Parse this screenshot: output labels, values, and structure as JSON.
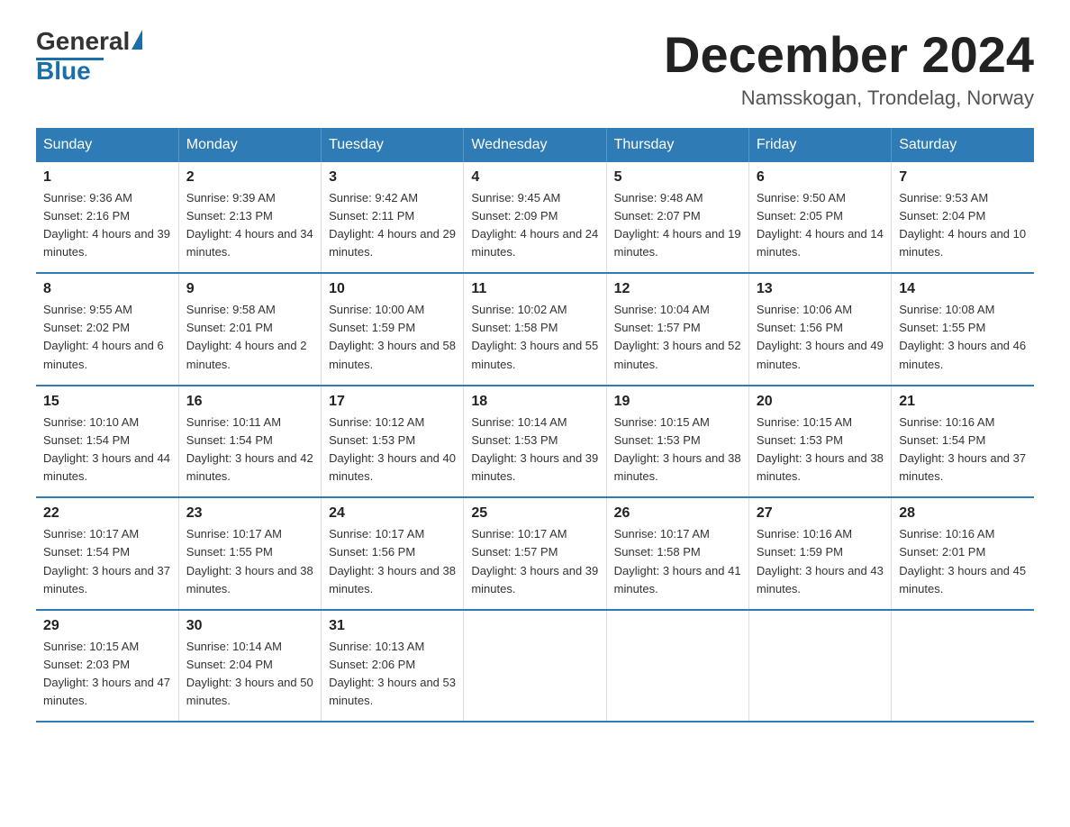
{
  "header": {
    "logo_general": "General",
    "logo_blue": "Blue",
    "month_title": "December 2024",
    "location": "Namsskogan, Trondelag, Norway"
  },
  "days_of_week": [
    "Sunday",
    "Monday",
    "Tuesday",
    "Wednesday",
    "Thursday",
    "Friday",
    "Saturday"
  ],
  "weeks": [
    [
      {
        "day": "1",
        "sunrise": "9:36 AM",
        "sunset": "2:16 PM",
        "daylight": "4 hours and 39 minutes."
      },
      {
        "day": "2",
        "sunrise": "9:39 AM",
        "sunset": "2:13 PM",
        "daylight": "4 hours and 34 minutes."
      },
      {
        "day": "3",
        "sunrise": "9:42 AM",
        "sunset": "2:11 PM",
        "daylight": "4 hours and 29 minutes."
      },
      {
        "day": "4",
        "sunrise": "9:45 AM",
        "sunset": "2:09 PM",
        "daylight": "4 hours and 24 minutes."
      },
      {
        "day": "5",
        "sunrise": "9:48 AM",
        "sunset": "2:07 PM",
        "daylight": "4 hours and 19 minutes."
      },
      {
        "day": "6",
        "sunrise": "9:50 AM",
        "sunset": "2:05 PM",
        "daylight": "4 hours and 14 minutes."
      },
      {
        "day": "7",
        "sunrise": "9:53 AM",
        "sunset": "2:04 PM",
        "daylight": "4 hours and 10 minutes."
      }
    ],
    [
      {
        "day": "8",
        "sunrise": "9:55 AM",
        "sunset": "2:02 PM",
        "daylight": "4 hours and 6 minutes."
      },
      {
        "day": "9",
        "sunrise": "9:58 AM",
        "sunset": "2:01 PM",
        "daylight": "4 hours and 2 minutes."
      },
      {
        "day": "10",
        "sunrise": "10:00 AM",
        "sunset": "1:59 PM",
        "daylight": "3 hours and 58 minutes."
      },
      {
        "day": "11",
        "sunrise": "10:02 AM",
        "sunset": "1:58 PM",
        "daylight": "3 hours and 55 minutes."
      },
      {
        "day": "12",
        "sunrise": "10:04 AM",
        "sunset": "1:57 PM",
        "daylight": "3 hours and 52 minutes."
      },
      {
        "day": "13",
        "sunrise": "10:06 AM",
        "sunset": "1:56 PM",
        "daylight": "3 hours and 49 minutes."
      },
      {
        "day": "14",
        "sunrise": "10:08 AM",
        "sunset": "1:55 PM",
        "daylight": "3 hours and 46 minutes."
      }
    ],
    [
      {
        "day": "15",
        "sunrise": "10:10 AM",
        "sunset": "1:54 PM",
        "daylight": "3 hours and 44 minutes."
      },
      {
        "day": "16",
        "sunrise": "10:11 AM",
        "sunset": "1:54 PM",
        "daylight": "3 hours and 42 minutes."
      },
      {
        "day": "17",
        "sunrise": "10:12 AM",
        "sunset": "1:53 PM",
        "daylight": "3 hours and 40 minutes."
      },
      {
        "day": "18",
        "sunrise": "10:14 AM",
        "sunset": "1:53 PM",
        "daylight": "3 hours and 39 minutes."
      },
      {
        "day": "19",
        "sunrise": "10:15 AM",
        "sunset": "1:53 PM",
        "daylight": "3 hours and 38 minutes."
      },
      {
        "day": "20",
        "sunrise": "10:15 AM",
        "sunset": "1:53 PM",
        "daylight": "3 hours and 38 minutes."
      },
      {
        "day": "21",
        "sunrise": "10:16 AM",
        "sunset": "1:54 PM",
        "daylight": "3 hours and 37 minutes."
      }
    ],
    [
      {
        "day": "22",
        "sunrise": "10:17 AM",
        "sunset": "1:54 PM",
        "daylight": "3 hours and 37 minutes."
      },
      {
        "day": "23",
        "sunrise": "10:17 AM",
        "sunset": "1:55 PM",
        "daylight": "3 hours and 38 minutes."
      },
      {
        "day": "24",
        "sunrise": "10:17 AM",
        "sunset": "1:56 PM",
        "daylight": "3 hours and 38 minutes."
      },
      {
        "day": "25",
        "sunrise": "10:17 AM",
        "sunset": "1:57 PM",
        "daylight": "3 hours and 39 minutes."
      },
      {
        "day": "26",
        "sunrise": "10:17 AM",
        "sunset": "1:58 PM",
        "daylight": "3 hours and 41 minutes."
      },
      {
        "day": "27",
        "sunrise": "10:16 AM",
        "sunset": "1:59 PM",
        "daylight": "3 hours and 43 minutes."
      },
      {
        "day": "28",
        "sunrise": "10:16 AM",
        "sunset": "2:01 PM",
        "daylight": "3 hours and 45 minutes."
      }
    ],
    [
      {
        "day": "29",
        "sunrise": "10:15 AM",
        "sunset": "2:03 PM",
        "daylight": "3 hours and 47 minutes."
      },
      {
        "day": "30",
        "sunrise": "10:14 AM",
        "sunset": "2:04 PM",
        "daylight": "3 hours and 50 minutes."
      },
      {
        "day": "31",
        "sunrise": "10:13 AM",
        "sunset": "2:06 PM",
        "daylight": "3 hours and 53 minutes."
      },
      null,
      null,
      null,
      null
    ]
  ],
  "labels": {
    "sunrise_prefix": "Sunrise: ",
    "sunset_prefix": "Sunset: ",
    "daylight_prefix": "Daylight: "
  }
}
